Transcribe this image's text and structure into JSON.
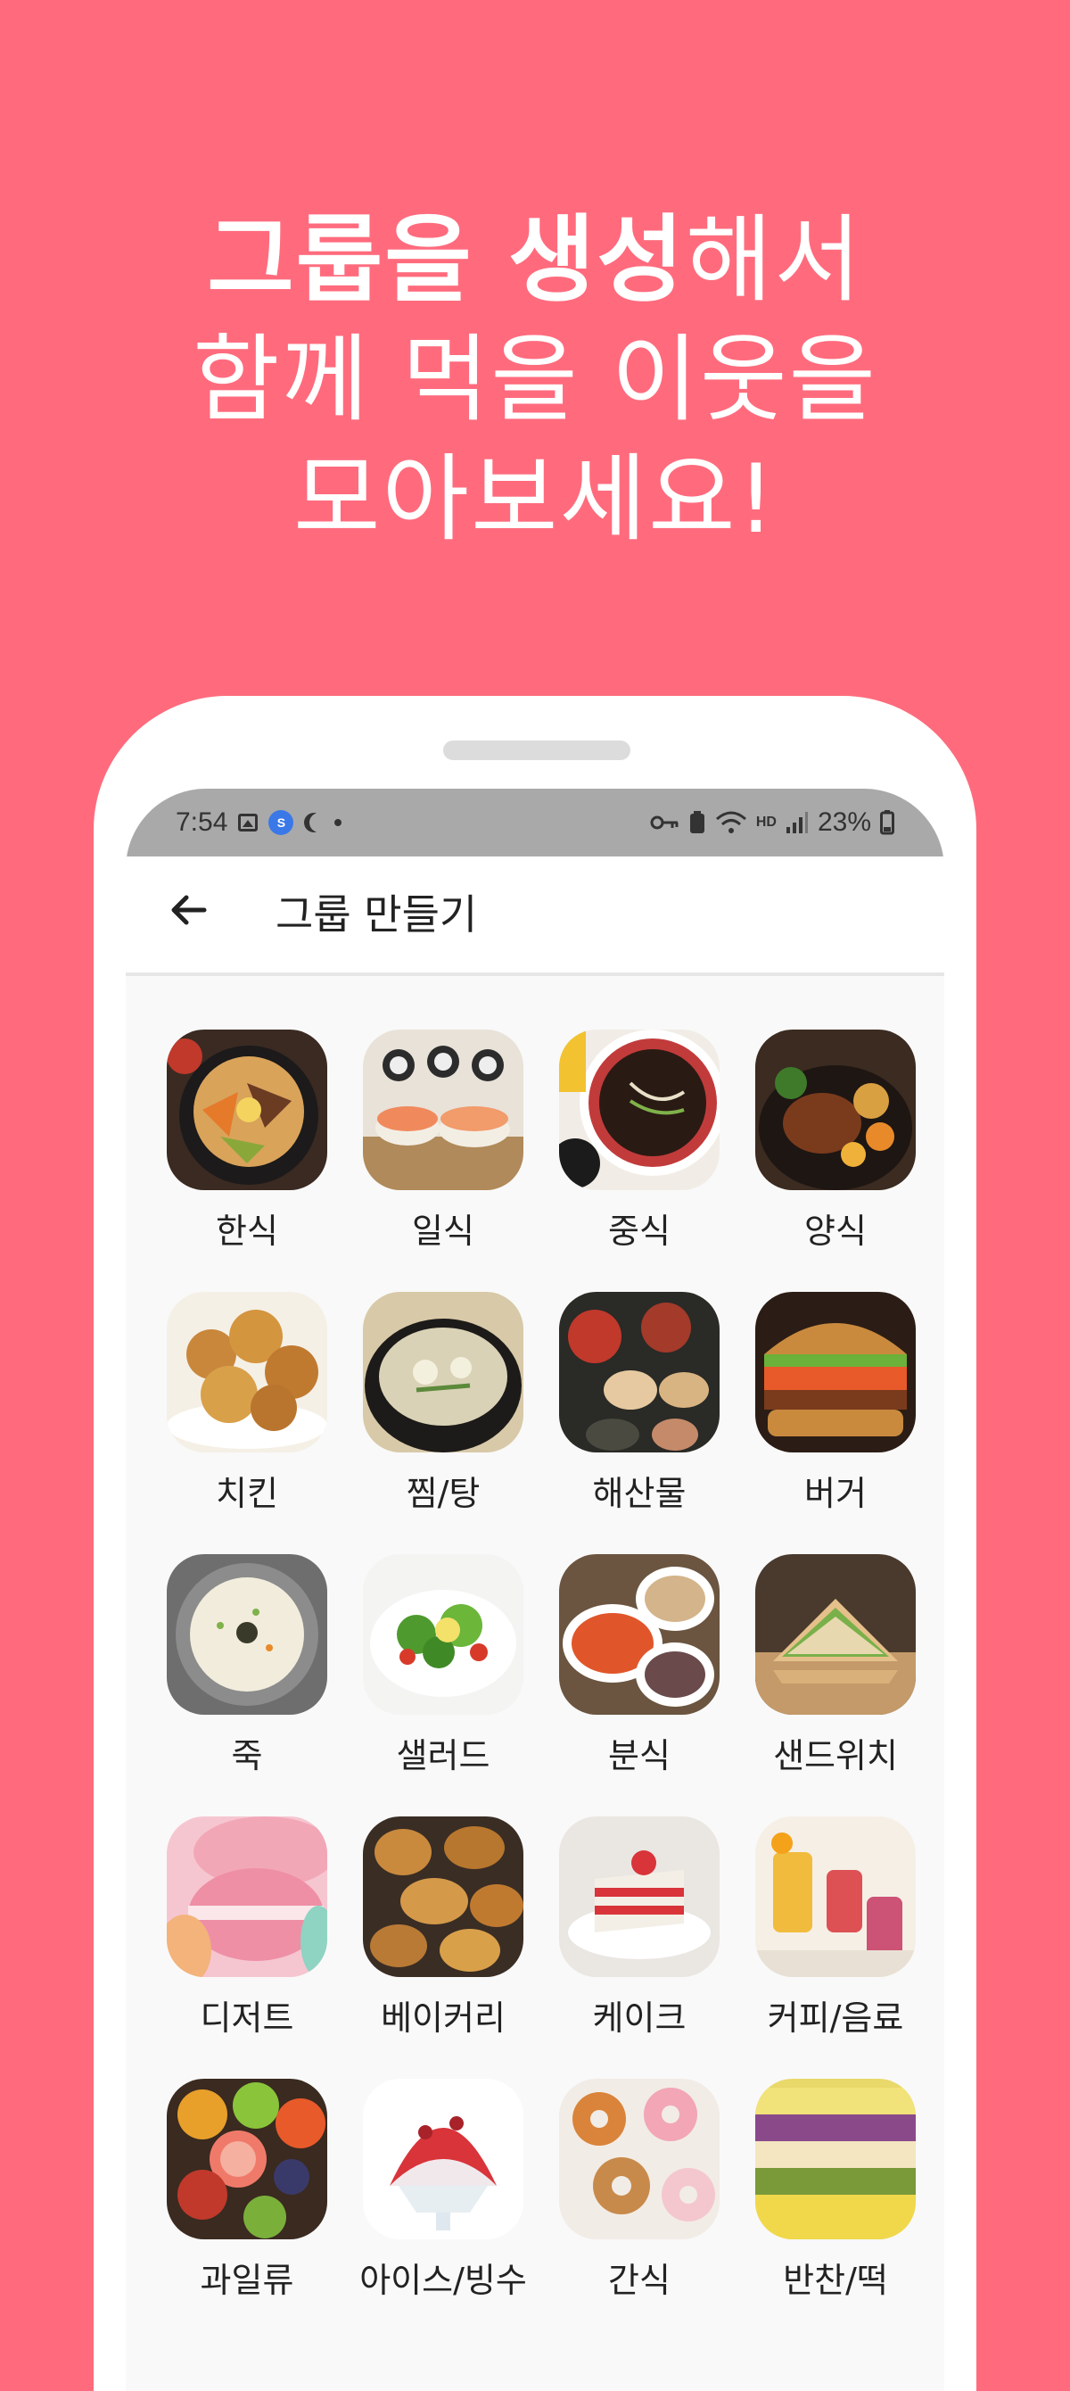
{
  "promo": {
    "line1_bold_a": "그룹을 ",
    "line1_bold_b": "생성",
    "line1_rest": "해서",
    "line2": "함께 먹을 이웃을",
    "line3": "모아보세요!"
  },
  "status_bar": {
    "time": "7:54",
    "battery": "23%",
    "network_label": "HD"
  },
  "app_bar": {
    "title": "그룹 만들기"
  },
  "categories": [
    {
      "label": "한식",
      "icon": "bibimbap-photo"
    },
    {
      "label": "일식",
      "icon": "sushi-photo"
    },
    {
      "label": "중식",
      "icon": "jajangmyeon-photo"
    },
    {
      "label": "양식",
      "icon": "steak-photo"
    },
    {
      "label": "치킨",
      "icon": "fried-chicken-photo"
    },
    {
      "label": "찜/탕",
      "icon": "stew-photo"
    },
    {
      "label": "해산물",
      "icon": "seafood-photo"
    },
    {
      "label": "버거",
      "icon": "burger-photo"
    },
    {
      "label": "죽",
      "icon": "porridge-photo"
    },
    {
      "label": "샐러드",
      "icon": "salad-photo"
    },
    {
      "label": "분식",
      "icon": "tteokbokki-photo"
    },
    {
      "label": "샌드위치",
      "icon": "sandwich-photo"
    },
    {
      "label": "디저트",
      "icon": "macaron-photo"
    },
    {
      "label": "베이커리",
      "icon": "bread-photo"
    },
    {
      "label": "케이크",
      "icon": "cake-photo"
    },
    {
      "label": "커피/음료",
      "icon": "drinks-photo"
    },
    {
      "label": "과일류",
      "icon": "fruit-photo"
    },
    {
      "label": "아이스/빙수",
      "icon": "bingsu-photo"
    },
    {
      "label": "간식",
      "icon": "donut-photo"
    },
    {
      "label": "반찬/떡",
      "icon": "rice-cake-photo"
    }
  ]
}
